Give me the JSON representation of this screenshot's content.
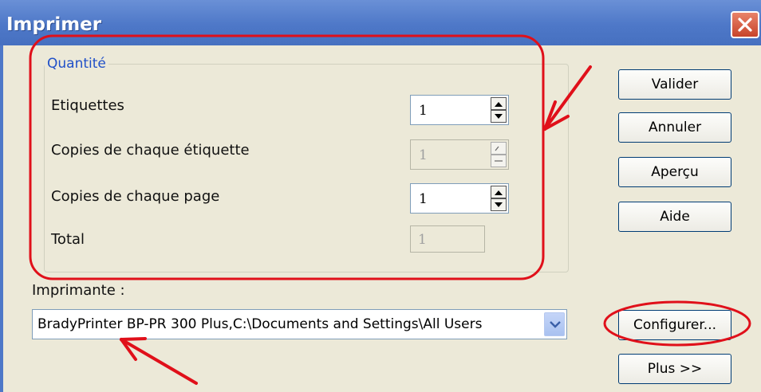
{
  "window": {
    "title": "Imprimer"
  },
  "quantity": {
    "legend": "Quantité",
    "etiquettes": {
      "label": "Etiquettes",
      "value": "1"
    },
    "copies_etiquette": {
      "label": "Copies de chaque étiquette",
      "value": "1"
    },
    "copies_page": {
      "label": "Copies de chaque page",
      "value": "1"
    },
    "total": {
      "label": "Total",
      "value": "1"
    }
  },
  "buttons": {
    "valider": "Valider",
    "annuler": "Annuler",
    "apercu": "Aperçu",
    "aide": "Aide",
    "configurer": "Configurer...",
    "plus": "Plus >>"
  },
  "printer": {
    "label": "Imprimante :",
    "selected": "BradyPrinter BP-PR 300 Plus,C:\\Documents and Settings\\All Users"
  },
  "annotation_color": "#e0101a",
  "icons": [
    "close-icon",
    "spin-up-icon",
    "spin-down-icon",
    "chevron-down-icon",
    "arrow-annotation"
  ]
}
